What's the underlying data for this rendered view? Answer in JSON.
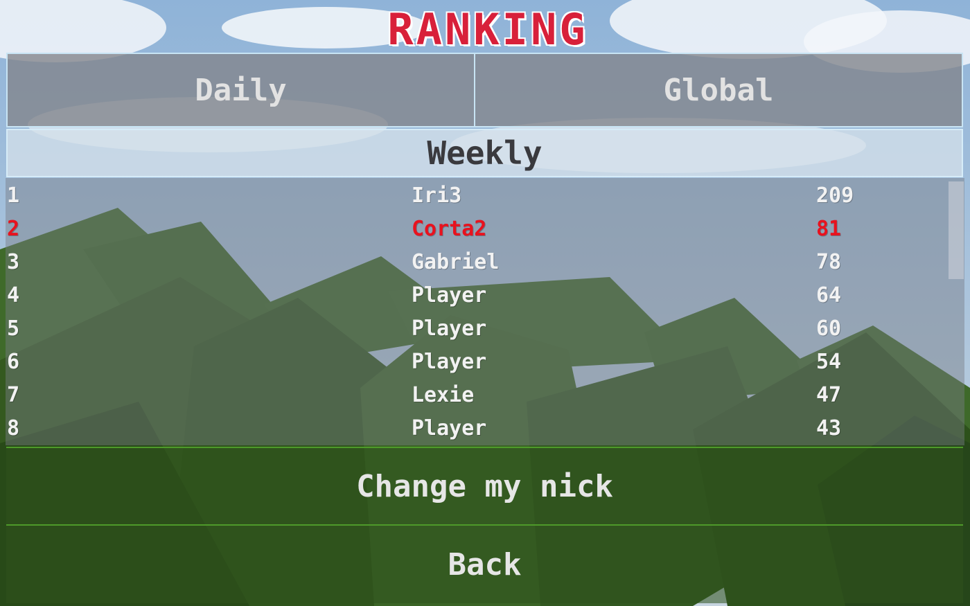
{
  "title": "RANKING",
  "tabs": {
    "daily": "Daily",
    "global": "Global",
    "weekly": "Weekly"
  },
  "active_tab": "Weekly",
  "ranking": [
    {
      "rank": "1",
      "name": "Iri3",
      "score": "209"
    },
    {
      "rank": "2",
      "name": "Corta2",
      "score": "81"
    },
    {
      "rank": "3",
      "name": "Gabriel",
      "score": "78"
    },
    {
      "rank": "4",
      "name": "Player",
      "score": "64"
    },
    {
      "rank": "5",
      "name": "Player",
      "score": "60"
    },
    {
      "rank": "6",
      "name": "Player",
      "score": "54"
    },
    {
      "rank": "7",
      "name": "Lexie",
      "score": "47"
    },
    {
      "rank": "8",
      "name": "Player",
      "score": "43"
    }
  ],
  "highlighted_rank": "2",
  "buttons": {
    "change_nick": "Change my nick",
    "back": "Back"
  },
  "colors": {
    "title": "#d8203a",
    "highlight_row": "#e8121e",
    "tab_active": "#d4e0ea",
    "tab_inactive": "#82848a",
    "button_bg": "#30521e"
  }
}
